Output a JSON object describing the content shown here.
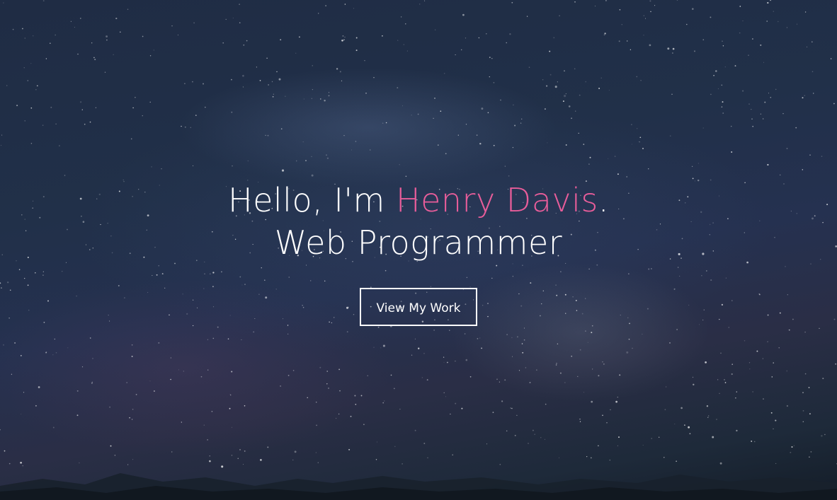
{
  "hero": {
    "greeting_prefix": "Hello, I'm ",
    "name": "Henry Davis",
    "greeting_suffix": ".",
    "role": "Web Programmer",
    "button_label": "View My Work",
    "accent_color": "#e85d9a"
  }
}
